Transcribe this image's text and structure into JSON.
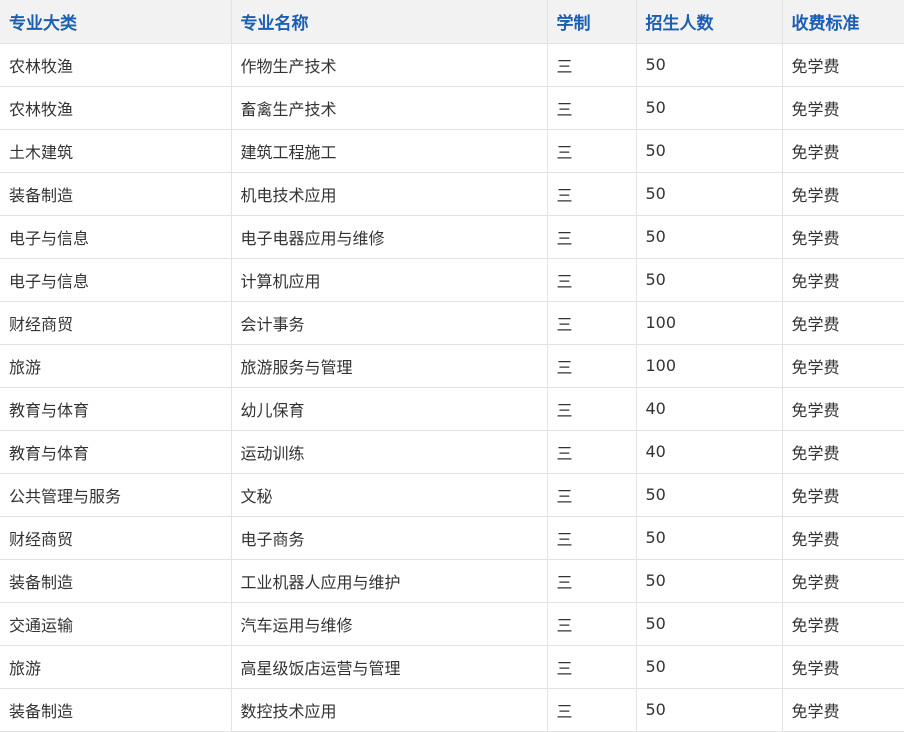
{
  "headers": [
    "专业大类",
    "专业名称",
    "学制",
    "招生人数",
    "收费标准"
  ],
  "rows": [
    [
      "农林牧渔",
      "作物生产技术",
      "三",
      "50",
      "免学费"
    ],
    [
      "农林牧渔",
      "畜禽生产技术",
      "三",
      "50",
      "免学费"
    ],
    [
      "土木建筑",
      "建筑工程施工",
      "三",
      "50",
      "免学费"
    ],
    [
      "装备制造",
      "机电技术应用",
      "三",
      "50",
      "免学费"
    ],
    [
      "电子与信息",
      "电子电器应用与维修",
      "三",
      "50",
      "免学费"
    ],
    [
      "电子与信息",
      "计算机应用",
      "三",
      "50",
      "免学费"
    ],
    [
      "财经商贸",
      "会计事务",
      "三",
      "100",
      "免学费"
    ],
    [
      "旅游",
      "旅游服务与管理",
      "三",
      "100",
      "免学费"
    ],
    [
      "教育与体育",
      "幼儿保育",
      "三",
      "40",
      "免学费"
    ],
    [
      "教育与体育",
      "运动训练",
      "三",
      "40",
      "免学费"
    ],
    [
      "公共管理与服务",
      "文秘",
      "三",
      "50",
      "免学费"
    ],
    [
      "财经商贸",
      "电子商务",
      "三",
      "50",
      "免学费"
    ],
    [
      "装备制造",
      "工业机器人应用与维护",
      "三",
      "50",
      "免学费"
    ],
    [
      "交通运输",
      "汽车运用与维修",
      "三",
      "50",
      "免学费"
    ],
    [
      "旅游",
      "高星级饭店运营与管理",
      "三",
      "50",
      "免学费"
    ],
    [
      "装备制造",
      "数控技术应用",
      "三",
      "50",
      "免学费"
    ]
  ]
}
